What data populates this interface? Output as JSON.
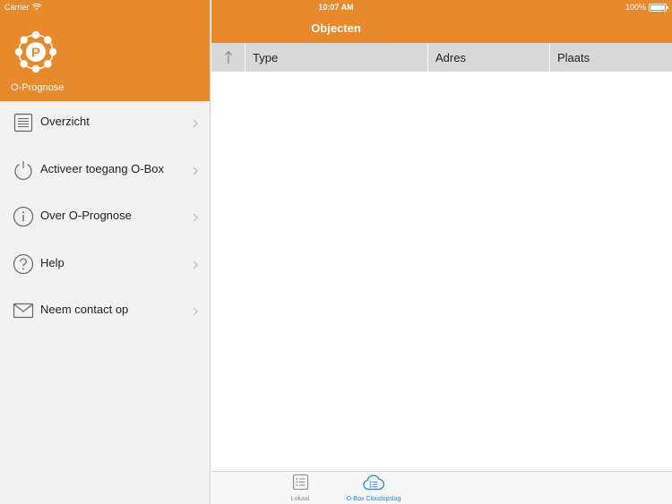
{
  "status_bar": {
    "carrier": "Carrier",
    "time": "10:07 AM",
    "battery": "100%"
  },
  "sidebar": {
    "app_name": "O-Prognose",
    "items": [
      {
        "label": "Overzicht",
        "icon": "list-icon"
      },
      {
        "label": "Activeer toegang O-Box",
        "icon": "power-icon"
      },
      {
        "label": "Over O-Prognose",
        "icon": "info-icon"
      },
      {
        "label": "Help",
        "icon": "help-icon"
      },
      {
        "label": "Neem contact op",
        "icon": "mail-icon"
      }
    ]
  },
  "main": {
    "title": "Objecten",
    "columns": [
      "Type",
      "Adres",
      "Plaats"
    ],
    "sort_icon": "sort-up-arrow-icon"
  },
  "tab_bar": {
    "tabs": [
      {
        "label": "Lokaal",
        "icon": "list-icon",
        "selected": false
      },
      {
        "label": "O-Box Cloudopslag",
        "icon": "cloud-list-icon",
        "selected": true
      }
    ]
  },
  "colors": {
    "accent": "#e8892b",
    "selected_tab": "#2a86e0",
    "sidebar_bg": "#f2f2f2",
    "table_header_bg": "#d8d8d8"
  }
}
